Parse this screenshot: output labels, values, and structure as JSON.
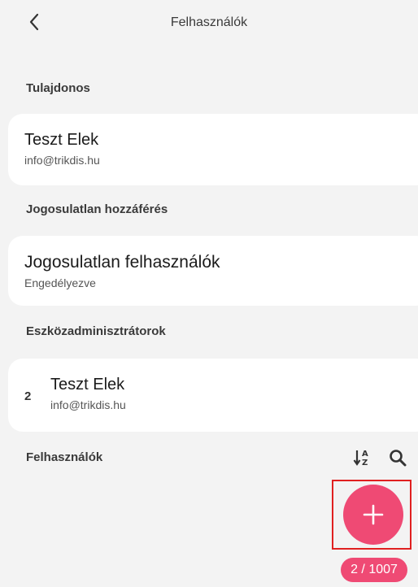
{
  "header": {
    "title": "Felhasználók"
  },
  "owner": {
    "section_label": "Tulajdonos",
    "name": "Teszt Elek",
    "email": "info@trikdis.hu"
  },
  "unauthorized": {
    "section_label": "Jogosulatlan hozzáférés",
    "title": "Jogosulatlan felhasználók",
    "status": "Engedélyezve"
  },
  "admins": {
    "section_label": "Eszközadminisztrátorok",
    "items": [
      {
        "number": "2",
        "name": "Teszt Elek",
        "email": "info@trikdis.hu"
      }
    ]
  },
  "users": {
    "section_label": "Felhasználók",
    "counter": "2 / 1007"
  },
  "icons": {
    "back": "chevron-left-icon",
    "sort": "sort-alpha-icon",
    "search": "search-icon",
    "add": "plus-icon"
  },
  "colors": {
    "accent": "#ef4a74",
    "highlight_frame": "#e02020",
    "background": "#f3f3f3",
    "card": "#ffffff"
  }
}
